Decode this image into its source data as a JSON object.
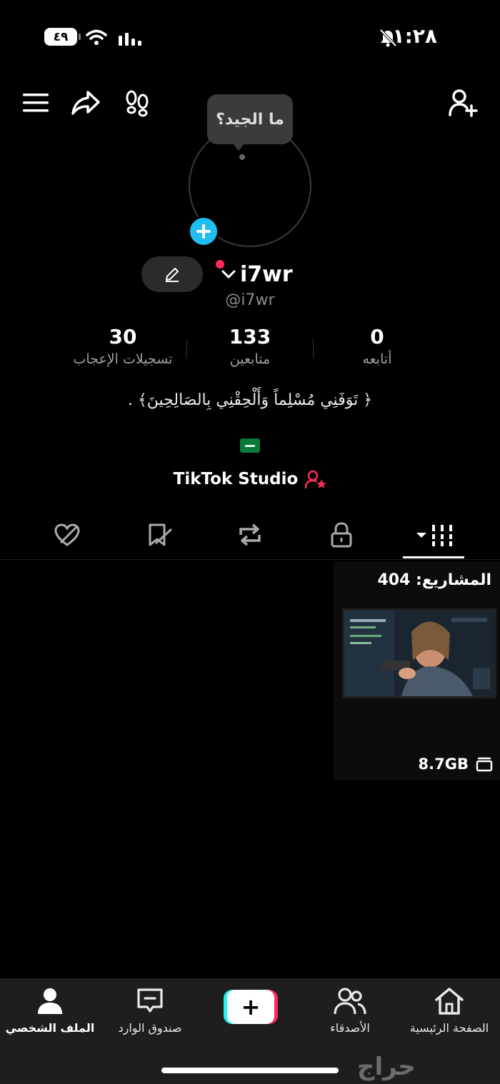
{
  "status_bar": {
    "battery": "٤٩",
    "time": "١:٢٨"
  },
  "tooltip": {
    "text": "ما الجيد؟"
  },
  "profile": {
    "username": "i7wr",
    "handle": "@i7wr",
    "bio": "﴿ تَوَفَنِي مُسْلِماً وَأَلْحِقْنِي بِالصَالِحِينَ﴾ .",
    "studio_label": "TikTok Studio"
  },
  "stats": {
    "likes": {
      "value": "30",
      "label": "تسجيلات الإعجاب"
    },
    "followers": {
      "value": "133",
      "label": "متابعين"
    },
    "following": {
      "value": "0",
      "label": "أتابعه"
    }
  },
  "drafts_card": {
    "title": "المشاريع: 404",
    "size": "8.7GB"
  },
  "bottom_nav": {
    "home": "الصفحة الرئيسية",
    "friends": "الأصدقاء",
    "create": "+",
    "inbox": "صندوق الوارد",
    "profile": "الملف الشخصي"
  },
  "watermark": "حراج",
  "colors": {
    "accent_blue": "#20bdf0",
    "accent_red": "#fe2c55",
    "accent_cyan": "#25f4ee",
    "background": "#000000"
  }
}
